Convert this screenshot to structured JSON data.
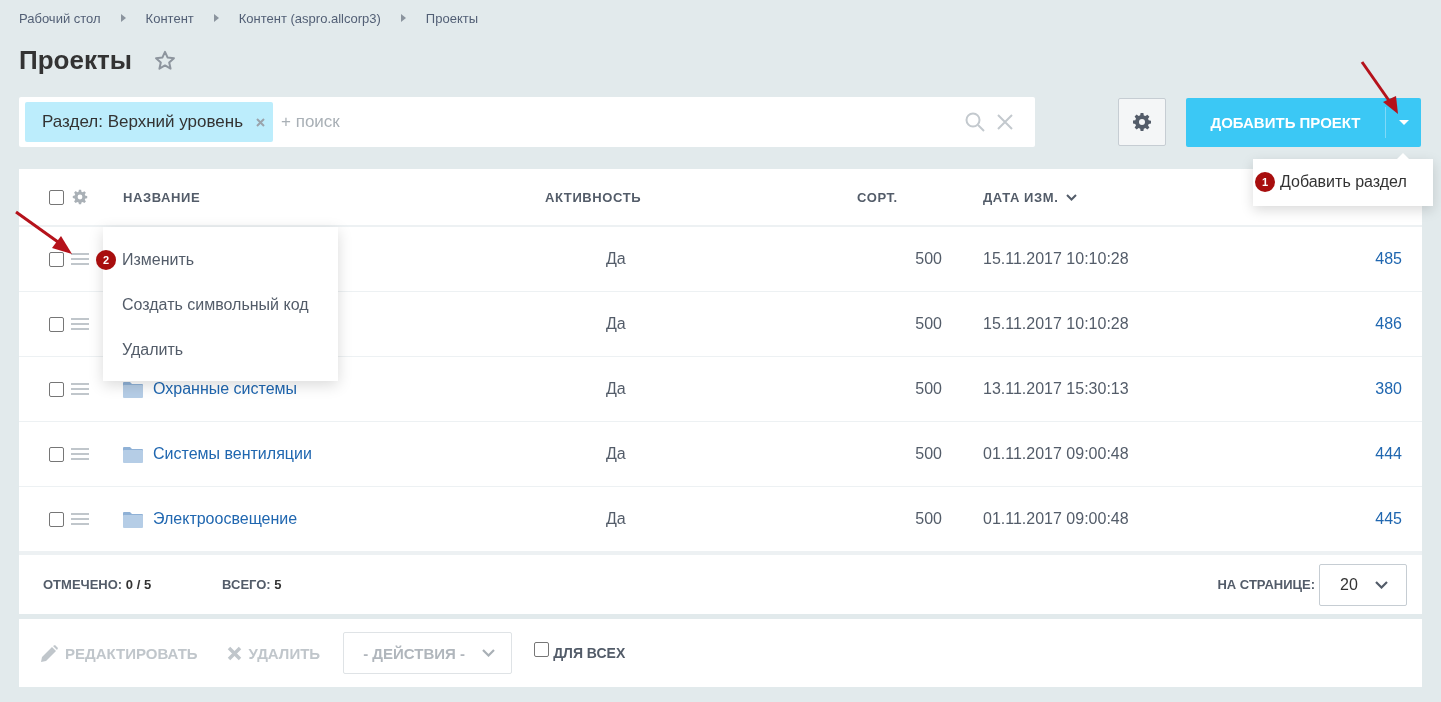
{
  "breadcrumbs": [
    "Рабочий стол",
    "Контент",
    "Контент (aspro.allcorp3)",
    "Проекты"
  ],
  "title": "Проекты",
  "filter": {
    "tag": "Раздел: Верхний уровень",
    "placeholder": "+ поиск"
  },
  "add_button": {
    "label": "ДОБАВИТЬ ПРОЕКТ"
  },
  "add_menu": {
    "badge": "1",
    "items": [
      "Добавить раздел"
    ]
  },
  "table": {
    "header_checked": false,
    "columns": [
      {
        "label": "НАЗВАНИЕ",
        "sorted": false
      },
      {
        "label": "АКТИВНОСТЬ",
        "sorted": false
      },
      {
        "label": "СОРТ.",
        "sorted": false
      },
      {
        "label": "ДАТА ИЗМ.",
        "sorted": true
      }
    ],
    "rows": [
      {
        "checked": false,
        "active": "Да",
        "sort": "500",
        "date": "15.11.2017 10:10:28",
        "id": "485"
      },
      {
        "checked": false,
        "active": "Да",
        "sort": "500",
        "date": "15.11.2017 10:10:28",
        "id": "486"
      },
      {
        "checked": false,
        "name": "Охранные системы",
        "active": "Да",
        "sort": "500",
        "date": "13.11.2017 15:30:13",
        "id": "380"
      },
      {
        "checked": false,
        "name": "Системы вентиляции",
        "active": "Да",
        "sort": "500",
        "date": "01.11.2017 09:00:48",
        "id": "444"
      },
      {
        "checked": false,
        "name": "Электроосвещение",
        "active": "Да",
        "sort": "500",
        "date": "01.11.2017 09:00:48",
        "id": "445"
      }
    ]
  },
  "row_menu": {
    "badge": "2",
    "items": [
      "Изменить",
      "Создать символьный код",
      "Удалить"
    ]
  },
  "footer": {
    "checked_label": "ОТМЕЧЕНО:",
    "checked_value": "0 / 5",
    "total_label": "ВСЕГО:",
    "total_value": "5",
    "per_page_label": "НА СТРАНИЦЕ:",
    "per_page": "20"
  },
  "actions": {
    "buttons": [
      {
        "kind": "edit",
        "label": "РЕДАКТИРОВАТЬ",
        "disabled": true
      },
      {
        "kind": "delete",
        "label": "УДАЛИТЬ",
        "disabled": true
      }
    ],
    "select": "- ДЕЙСТВИЯ -",
    "for_all": "ДЛЯ ВСЕХ",
    "for_all_checked": false
  }
}
